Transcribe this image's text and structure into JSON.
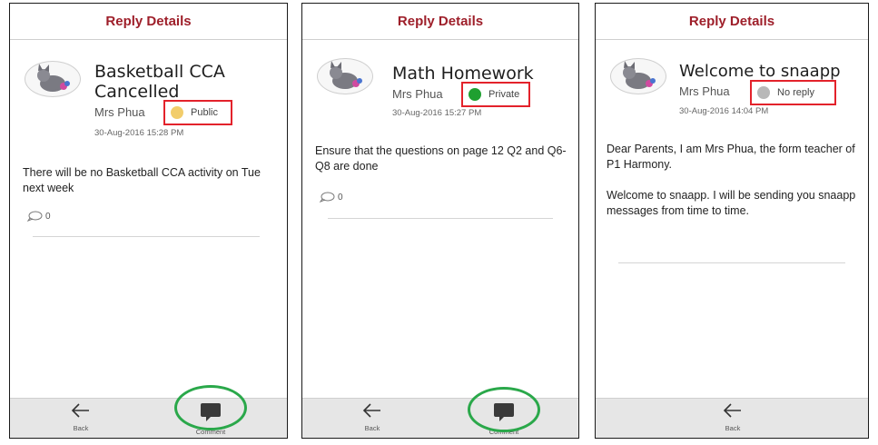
{
  "screens": [
    {
      "header": "Reply Details",
      "title": "Basketball CCA Cancelled",
      "sender": "Mrs Phua",
      "visibility": "Public",
      "visibility_color": "#f2cd6b",
      "date": "30-Aug-2016  15:28 PM",
      "body": "There will be no Basketball CCA activity on Tue next week",
      "comment_count": "0",
      "back_label": "Back",
      "comment_label": "Comment"
    },
    {
      "header": "Reply Details",
      "title": "Math Homework",
      "sender": "Mrs Phua",
      "visibility": "Private",
      "visibility_color": "#1fa030",
      "date": "30-Aug-2016  15:27 PM",
      "body": "Ensure that the questions on page 12 Q2 and Q6-Q8 are done",
      "comment_count": "0",
      "back_label": "Back",
      "comment_label": "Comment"
    },
    {
      "header": "Reply Details",
      "title": "Welcome to snaapp",
      "sender": "Mrs Phua",
      "visibility": "No reply",
      "visibility_color": "#b8b8b8",
      "date": "30-Aug-2016  14:04 PM",
      "body_p1": "Dear Parents, I am Mrs Phua, the form teacher of P1 Harmony.",
      "body_p2": "Welcome to snaapp. I will be sending you snaapp messages from time to time.",
      "back_label": "Back"
    }
  ],
  "colors": {
    "header_text": "#9e1f2a",
    "highlight_box": "#e3222b",
    "highlight_circle": "#2aa84a",
    "footer_bg": "#e6e6e6"
  },
  "icons": {
    "avatar": "cat-avatar-icon",
    "back": "arrow-left-icon",
    "comment": "speech-bubble-icon",
    "comment_count": "speech-bubble-outline-icon"
  }
}
